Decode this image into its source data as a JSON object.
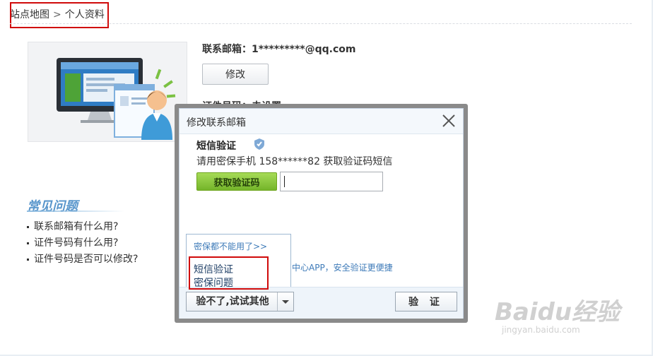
{
  "breadcrumb": {
    "home": "站点地图",
    "separator": ">",
    "current": "个人资料"
  },
  "profile": {
    "email_label": "联系邮箱：",
    "email_value": "1*********@qq.com",
    "modify_button": "修改",
    "id_label": "证件号码：",
    "id_value": "未设置"
  },
  "faq": {
    "title": "常见问题",
    "items": [
      "联系邮箱有什么用?",
      "证件号码有什么用?",
      "证件号码是否可以修改?"
    ]
  },
  "dialog": {
    "title": "修改联系邮箱",
    "sms_title": "短信验证",
    "sms_desc": "请用密保手机 158******82 获取验证码短信",
    "get_code_button": "获取验证码",
    "code_input_value": "",
    "popup": {
      "link": "密保都不能用了>>",
      "options": [
        "短信验证",
        "密保问题"
      ]
    },
    "app_hint": "中心APP，安全验证更便捷",
    "other_button": "验不了,试试其他",
    "verify_button": "验 证"
  },
  "watermark": {
    "logo": "Baidu经验",
    "url": "jingyan.baidu.com"
  },
  "colors": {
    "annotation": "#d00a0a",
    "accent_green": "#74b52a",
    "link_blue": "#3d7ab8",
    "faq_blue": "#5a97cc"
  }
}
